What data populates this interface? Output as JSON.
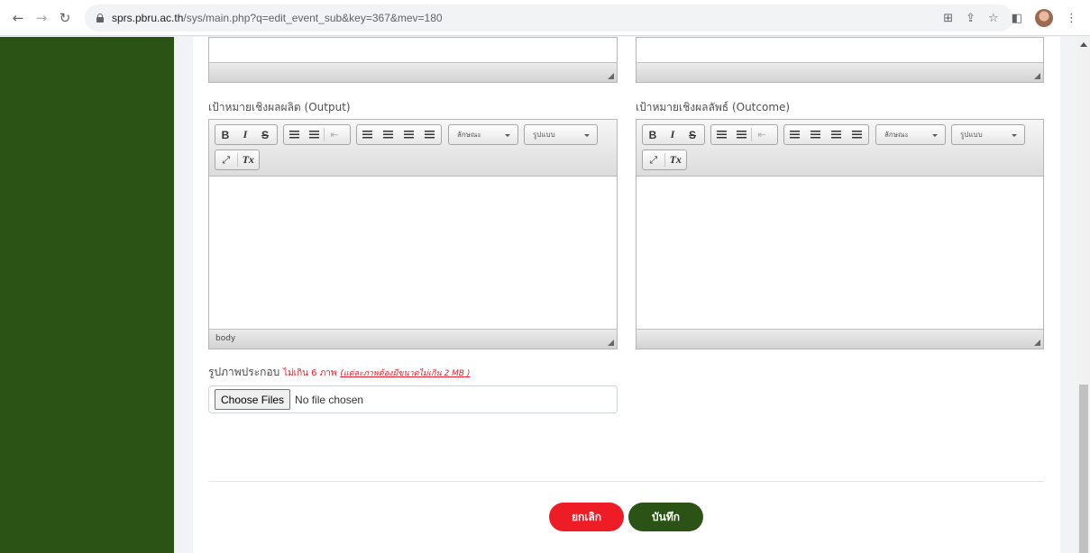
{
  "browser": {
    "url_host": "sprs.pbru.ac.th",
    "url_path": "/sys/main.php?q=edit_event_sub&key=367&mev=180"
  },
  "form": {
    "output_label": "เป้าหมายเชิงผลผลิต (Output)",
    "outcome_label": "เป้าหมายเชิงผลลัพธ์ (Outcome)",
    "editor_toolbar": {
      "bold": "B",
      "italic": "I",
      "strike": "S",
      "remove_format": "Tx",
      "style_combo": "ลักษณะ",
      "format_combo": "รูปแบบ"
    },
    "output_footer_path": "body",
    "photo_label": "รูปภาพประกอบ",
    "photo_limit": "ไม่เกิน 6 ภาพ",
    "photo_size_note": "(แต่ละภาพต้องมีขนาดไม่เกิน 2 MB )",
    "file_button": "Choose Files",
    "file_status": "No file chosen",
    "cancel_button": "ยกเลิก",
    "save_button": "บันทึก"
  },
  "colors": {
    "sidebar": "#2a5315",
    "cancel": "#ee1c25",
    "save": "#2a5315",
    "warning_text": "#e0202a"
  }
}
